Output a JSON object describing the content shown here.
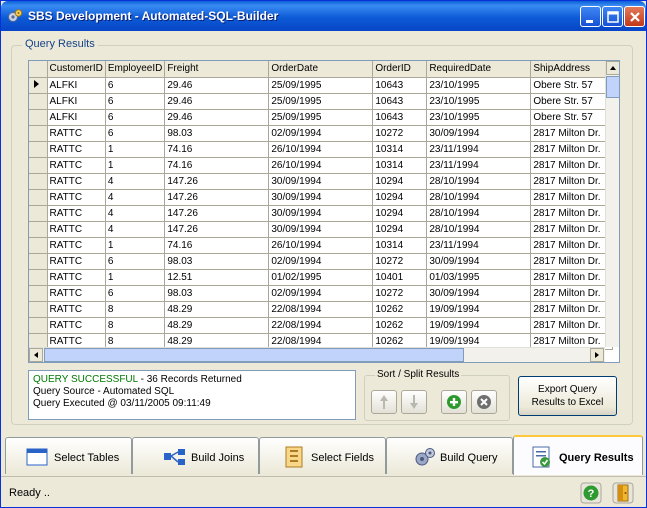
{
  "window": {
    "title": "SBS Development - Automated-SQL-Builder"
  },
  "results_group": {
    "label": "Query Results"
  },
  "table": {
    "columns": [
      "CustomerID",
      "EmployeeID",
      "Freight",
      "OrderDate",
      "OrderID",
      "RequiredDate",
      "ShipAddress"
    ],
    "rows": [
      [
        "ALFKI",
        "6",
        "29.46",
        "25/09/1995",
        "10643",
        "23/10/1995",
        "Obere Str. 57"
      ],
      [
        "ALFKI",
        "6",
        "29.46",
        "25/09/1995",
        "10643",
        "23/10/1995",
        "Obere Str. 57"
      ],
      [
        "ALFKI",
        "6",
        "29.46",
        "25/09/1995",
        "10643",
        "23/10/1995",
        "Obere Str. 57"
      ],
      [
        "RATTC",
        "6",
        "98.03",
        "02/09/1994",
        "10272",
        "30/09/1994",
        "2817 Milton Dr."
      ],
      [
        "RATTC",
        "1",
        "74.16",
        "26/10/1994",
        "10314",
        "23/11/1994",
        "2817 Milton Dr."
      ],
      [
        "RATTC",
        "1",
        "74.16",
        "26/10/1994",
        "10314",
        "23/11/1994",
        "2817 Milton Dr."
      ],
      [
        "RATTC",
        "4",
        "147.26",
        "30/09/1994",
        "10294",
        "28/10/1994",
        "2817 Milton Dr."
      ],
      [
        "RATTC",
        "4",
        "147.26",
        "30/09/1994",
        "10294",
        "28/10/1994",
        "2817 Milton Dr."
      ],
      [
        "RATTC",
        "4",
        "147.26",
        "30/09/1994",
        "10294",
        "28/10/1994",
        "2817 Milton Dr."
      ],
      [
        "RATTC",
        "4",
        "147.26",
        "30/09/1994",
        "10294",
        "28/10/1994",
        "2817 Milton Dr."
      ],
      [
        "RATTC",
        "1",
        "74.16",
        "26/10/1994",
        "10314",
        "23/11/1994",
        "2817 Milton Dr."
      ],
      [
        "RATTC",
        "6",
        "98.03",
        "02/09/1994",
        "10272",
        "30/09/1994",
        "2817 Milton Dr."
      ],
      [
        "RATTC",
        "1",
        "12.51",
        "01/02/1995",
        "10401",
        "01/03/1995",
        "2817 Milton Dr."
      ],
      [
        "RATTC",
        "6",
        "98.03",
        "02/09/1994",
        "10272",
        "30/09/1994",
        "2817 Milton Dr."
      ],
      [
        "RATTC",
        "8",
        "48.29",
        "22/08/1994",
        "10262",
        "19/09/1994",
        "2817 Milton Dr."
      ],
      [
        "RATTC",
        "8",
        "48.29",
        "22/08/1994",
        "10262",
        "19/09/1994",
        "2817 Milton Dr."
      ],
      [
        "RATTC",
        "8",
        "48.29",
        "22/08/1994",
        "10262",
        "19/09/1994",
        "2817 Milton Dr."
      ]
    ]
  },
  "status": {
    "success": "QUERY SUCCESSFUL",
    "records": " - 36 Records Returned",
    "source": "Query Source - Automated SQL",
    "executed": "Query Executed @ 03/11/2005 09:11:49"
  },
  "sort_group": {
    "label": "Sort / Split Results"
  },
  "export": {
    "line1": "Export Query",
    "line2": "Results to Excel"
  },
  "tabs": [
    "Select Tables",
    "Build Joins",
    "Select Fields",
    "Build Query",
    "Query Results"
  ],
  "statusbar": {
    "text": "Ready .."
  },
  "colors": {
    "title_bar": "#0a5fd6",
    "success_text": "#007a00",
    "active_tab_highlight": "#ffc83c"
  }
}
